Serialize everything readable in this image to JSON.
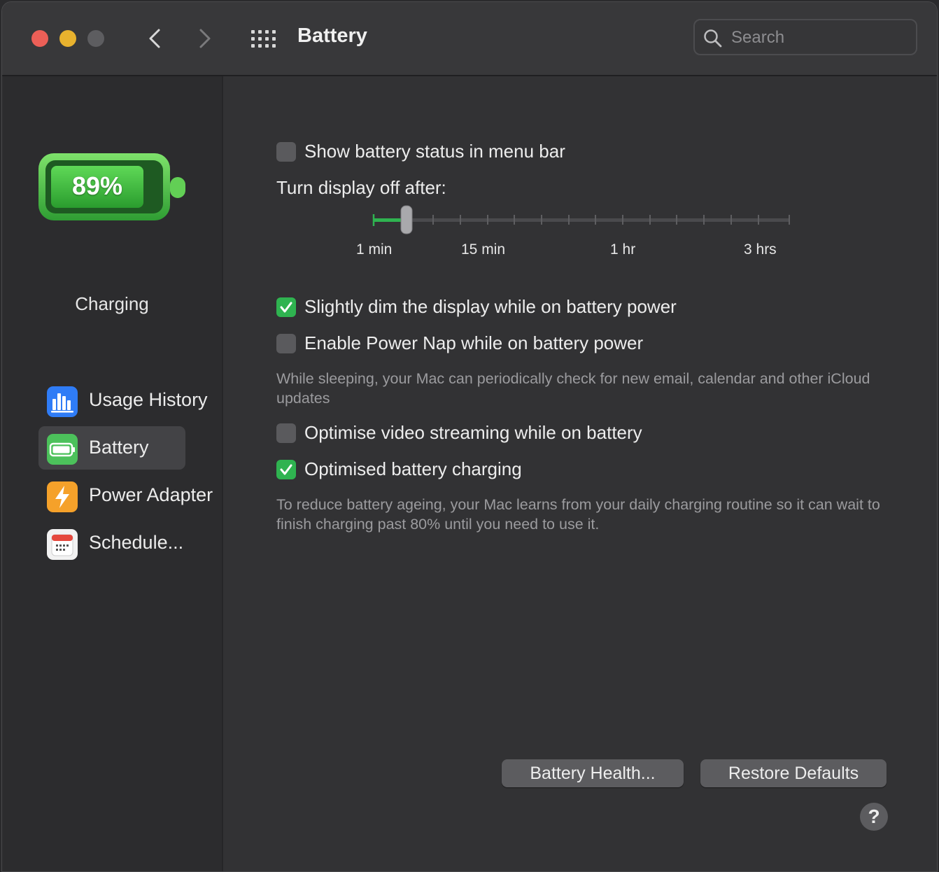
{
  "window": {
    "title": "Battery"
  },
  "search": {
    "placeholder": "Search"
  },
  "sidebar": {
    "battery_level": "89%",
    "status": "Charging",
    "items": [
      {
        "label": "Usage History",
        "icon": "usage-history-icon",
        "color": "#2f7cf6"
      },
      {
        "label": "Battery",
        "icon": "battery-icon",
        "color": "#4cc15b",
        "selected": true
      },
      {
        "label": "Power Adapter",
        "icon": "power-adapter-icon",
        "color": "#f5a12a"
      },
      {
        "label": "Schedule...",
        "icon": "schedule-icon",
        "color": "#f2f2f2"
      }
    ]
  },
  "settings": {
    "show_status": {
      "label": "Show battery status in menu bar",
      "checked": false
    },
    "display_off": {
      "label": "Turn display off after:",
      "ticks": [
        "1 min",
        "15 min",
        "1 hr",
        "3 hrs"
      ],
      "value": "1 min"
    },
    "dim_display": {
      "label": "Slightly dim the display while on battery power",
      "checked": true
    },
    "power_nap": {
      "label": "Enable Power Nap while on battery power",
      "checked": false,
      "description": "While sleeping, your Mac can periodically check for new email, calendar and other iCloud updates"
    },
    "video_streaming": {
      "label": "Optimise video streaming while on battery",
      "checked": false
    },
    "optimised_charging": {
      "label": "Optimised battery charging",
      "checked": true,
      "description": "To reduce battery ageing, your Mac learns from your daily charging routine so it can wait to finish charging past 80% until you need to use it."
    }
  },
  "buttons": {
    "battery_health": "Battery Health...",
    "restore_defaults": "Restore Defaults",
    "help": "?"
  },
  "colors": {
    "accent_green": "#2fb350",
    "battery_green": "#4cc15b"
  }
}
